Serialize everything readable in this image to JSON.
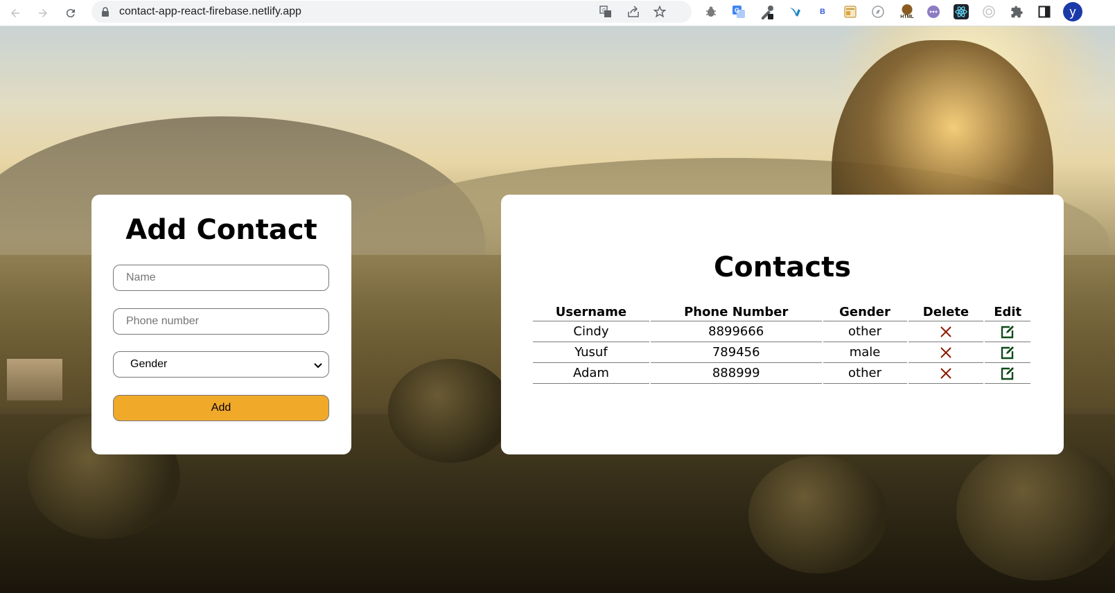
{
  "browser": {
    "url": "contact-app-react-firebase.netlify.app",
    "profile_initial": "y",
    "extensions": [
      {
        "name": "bug-extension-icon"
      },
      {
        "name": "translate-extension-icon"
      },
      {
        "name": "eyedropper-extension-icon"
      },
      {
        "name": "bird-extension-icon"
      },
      {
        "name": "b-extension-icon",
        "label": "B"
      },
      {
        "name": "layout-extension-icon"
      },
      {
        "name": "compass-extension-icon"
      },
      {
        "name": "html-extension-icon",
        "label": "HTML"
      },
      {
        "name": "chat-extension-icon"
      },
      {
        "name": "react-extension-icon"
      },
      {
        "name": "target-extension-icon"
      },
      {
        "name": "puzzle-icon"
      },
      {
        "name": "sidepanel-icon"
      }
    ]
  },
  "add_contact": {
    "title": "Add Contact",
    "name_placeholder": "Name",
    "phone_placeholder": "Phone number",
    "gender_selected": "Gender",
    "add_label": "Add",
    "add_color": "#f1a92a"
  },
  "contacts": {
    "title": "Contacts",
    "columns": [
      "Username",
      "Phone Number",
      "Gender",
      "Delete",
      "Edit"
    ],
    "rows": [
      {
        "username": "Cindy",
        "phone": "8899666",
        "gender": "other"
      },
      {
        "username": "Yusuf",
        "phone": "789456",
        "gender": "male"
      },
      {
        "username": "Adam",
        "phone": "888999",
        "gender": "other"
      }
    ],
    "delete_icon": "close-icon",
    "delete_color": "#8b1a00",
    "edit_icon": "edit-icon",
    "edit_color": "#0f4a1a"
  }
}
